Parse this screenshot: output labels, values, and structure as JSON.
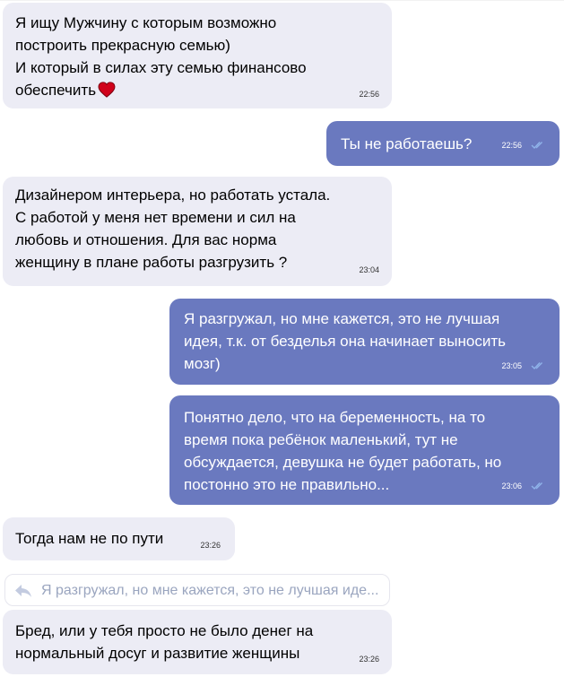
{
  "messages": [
    {
      "id": "m1",
      "direction": "incoming",
      "text": "Я ищу Мужчину с которым возможно\nпостроить прекрасную семью)\nИ который в силах эту семью финансово\nобеспечить",
      "emoji": "heart-icon",
      "time": "22:56"
    },
    {
      "id": "m2",
      "direction": "outgoing",
      "text": "Ты не работаешь?",
      "time": "22:56",
      "read": true
    },
    {
      "id": "m3",
      "direction": "incoming",
      "text": "Дизайнером интерьера, но работать устала.\nС работой у меня нет времени и сил на\nлюбовь и отношения. Для вас норма\nженщину в плане работы разгрузить ?",
      "time": "23:04"
    },
    {
      "id": "m4",
      "direction": "outgoing",
      "text": "Я разгружал, но мне кажется, это не лучшая\nидея, т.к. от безделья она начинает выносить\nмозг)",
      "time": "23:05",
      "read": true
    },
    {
      "id": "m5",
      "direction": "outgoing",
      "text": "Понятно дело, что на беременность, на то\nвремя пока ребёнок маленький, тут не\nобсуждается, девушка не будет работать, но\nпостонно это не правильно...",
      "time": "23:06",
      "read": true
    },
    {
      "id": "m6",
      "direction": "incoming",
      "text": "Тогда нам не по пути",
      "time": "23:26"
    },
    {
      "id": "m7",
      "direction": "incoming",
      "text": "Бред, или у тебя просто не было денег на\nнормальный досуг и развитие женщины",
      "time": "23:26"
    }
  ],
  "reply_preview": {
    "icon": "reply-arrow-icon",
    "text": "Я разгружал, но мне кажется, это не лучшая иде..."
  },
  "colors": {
    "incoming_bg": "#ececf5",
    "outgoing_bg": "#6a79bf",
    "read_check": "#8fb3ea",
    "heart": "#d0021b"
  }
}
